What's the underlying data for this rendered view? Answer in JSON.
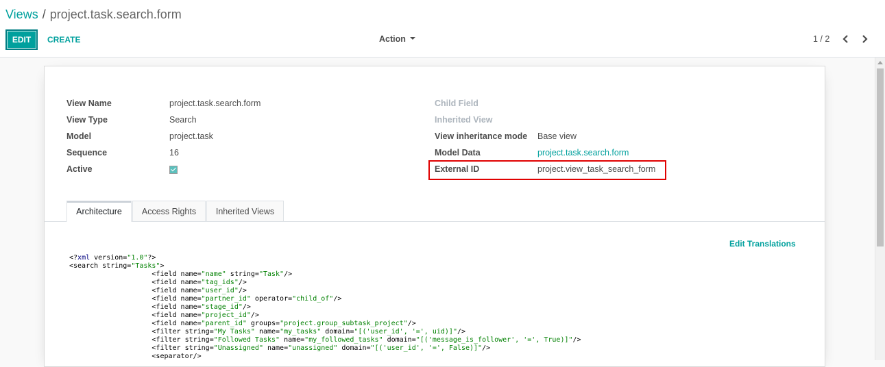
{
  "breadcrumb": {
    "parent": "Views",
    "separator": "/",
    "current": "project.task.search.form"
  },
  "toolbar": {
    "edit_label": "EDIT",
    "create_label": "CREATE",
    "action_label": "Action",
    "pager_text": "1 / 2"
  },
  "form": {
    "left": [
      {
        "label": "View Name",
        "value": "project.task.search.form"
      },
      {
        "label": "View Type",
        "value": "Search"
      },
      {
        "label": "Model",
        "value": "project.task"
      },
      {
        "label": "Sequence",
        "value": "16"
      },
      {
        "label": "Active",
        "value": ""
      }
    ],
    "right": [
      {
        "label": "Child Field",
        "value": ""
      },
      {
        "label": "Inherited View",
        "value": ""
      },
      {
        "label": "View inheritance mode",
        "value": "Base view"
      },
      {
        "label": "Model Data",
        "value": "project.task.search.form"
      },
      {
        "label": "External ID",
        "value": "project.view_task_search_form"
      }
    ],
    "active_checked": true
  },
  "tabs": [
    {
      "label": "Architecture",
      "active": true
    },
    {
      "label": "Access Rights",
      "active": false
    },
    {
      "label": "Inherited Views",
      "active": false
    }
  ],
  "edit_translations_label": "Edit Translations",
  "colors": {
    "accent": "#00a09d",
    "highlight": "#e00000"
  },
  "code_lines": [
    "<?xml version=\"1.0\"?>",
    "<search string=\"Tasks\">",
    "                    <field name=\"name\" string=\"Task\"/>",
    "                    <field name=\"tag_ids\"/>",
    "                    <field name=\"user_id\"/>",
    "                    <field name=\"partner_id\" operator=\"child_of\"/>",
    "                    <field name=\"stage_id\"/>",
    "                    <field name=\"project_id\"/>",
    "                    <field name=\"parent_id\" groups=\"project.group_subtask_project\"/>",
    "                    <filter string=\"My Tasks\" name=\"my_tasks\" domain=\"[('user_id', '=', uid)]\"/>",
    "                    <filter string=\"Followed Tasks\" name=\"my_followed_tasks\" domain=\"[('message_is_follower', '=', True)]\"/>",
    "                    <filter string=\"Unassigned\" name=\"unassigned\" domain=\"[('user_id', '=', False)]\"/>",
    "                    <separator/>"
  ]
}
